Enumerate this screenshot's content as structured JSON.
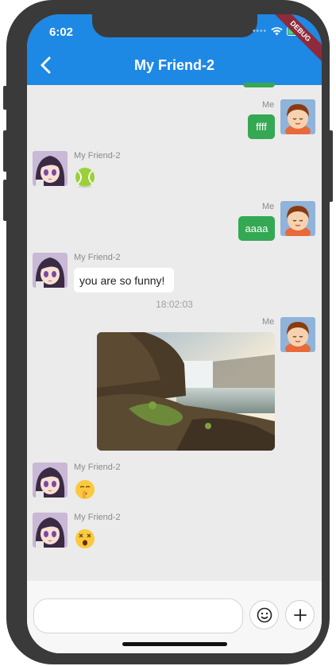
{
  "status_bar": {
    "time": "6:02",
    "debug_label": "DEBUG"
  },
  "header": {
    "title": "My Friend-2",
    "back_icon": "chevron-left-icon"
  },
  "colors": {
    "appbar": "#1e88e5",
    "my_bubble": "#34a853",
    "friend_bubble": "#ffffff",
    "chat_bg": "#ebebeb"
  },
  "messages": [
    {
      "sender": "Me",
      "type": "text",
      "text": "ffff"
    },
    {
      "sender": "My Friend-2",
      "type": "emoji",
      "emoji": "tennis-ball"
    },
    {
      "sender": "Me",
      "type": "text",
      "text": "aaaa"
    },
    {
      "sender": "My Friend-2",
      "type": "text",
      "text": "you are so funny!"
    },
    {
      "type": "timestamp",
      "text": "18:02:03"
    },
    {
      "sender": "Me",
      "type": "image",
      "image": "waterfall-photo"
    },
    {
      "sender": "My Friend-2",
      "type": "emoji",
      "emoji": "shushing-face"
    },
    {
      "sender": "My Friend-2",
      "type": "emoji",
      "emoji": "dizzy-face"
    }
  ],
  "composer": {
    "input_value": "",
    "emoji_icon": "smiley-icon",
    "plus_icon": "plus-icon"
  }
}
